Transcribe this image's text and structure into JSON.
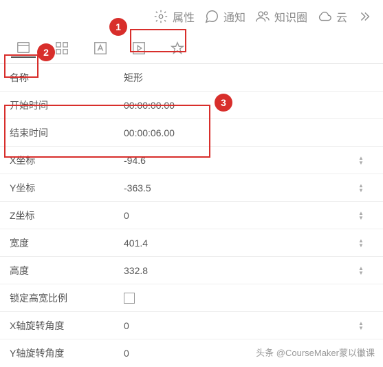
{
  "topbar": {
    "properties": "属性",
    "notifications": "通知",
    "knowledge": "知识圈",
    "cloud": "云"
  },
  "callouts": {
    "one": "1",
    "two": "2",
    "three": "3"
  },
  "rows": {
    "name": {
      "label": "名称",
      "value": "矩形"
    },
    "start": {
      "label": "开始时间",
      "value": "00:00:00.00"
    },
    "end": {
      "label": "结束时间",
      "value": "00:00:06.00"
    },
    "x": {
      "label": "X坐标",
      "value": "-94.6"
    },
    "y": {
      "label": "Y坐标",
      "value": "-363.5"
    },
    "z": {
      "label": "Z坐标",
      "value": "0"
    },
    "width": {
      "label": "宽度",
      "value": "401.4"
    },
    "height": {
      "label": "高度",
      "value": "332.8"
    },
    "lock": {
      "label": "锁定高宽比例"
    },
    "rotx": {
      "label": "X轴旋转角度",
      "value": "0"
    },
    "roty": {
      "label": "Y轴旋转角度",
      "value": "0"
    }
  },
  "watermark": "头条 @CourseMaker蒙以微课"
}
